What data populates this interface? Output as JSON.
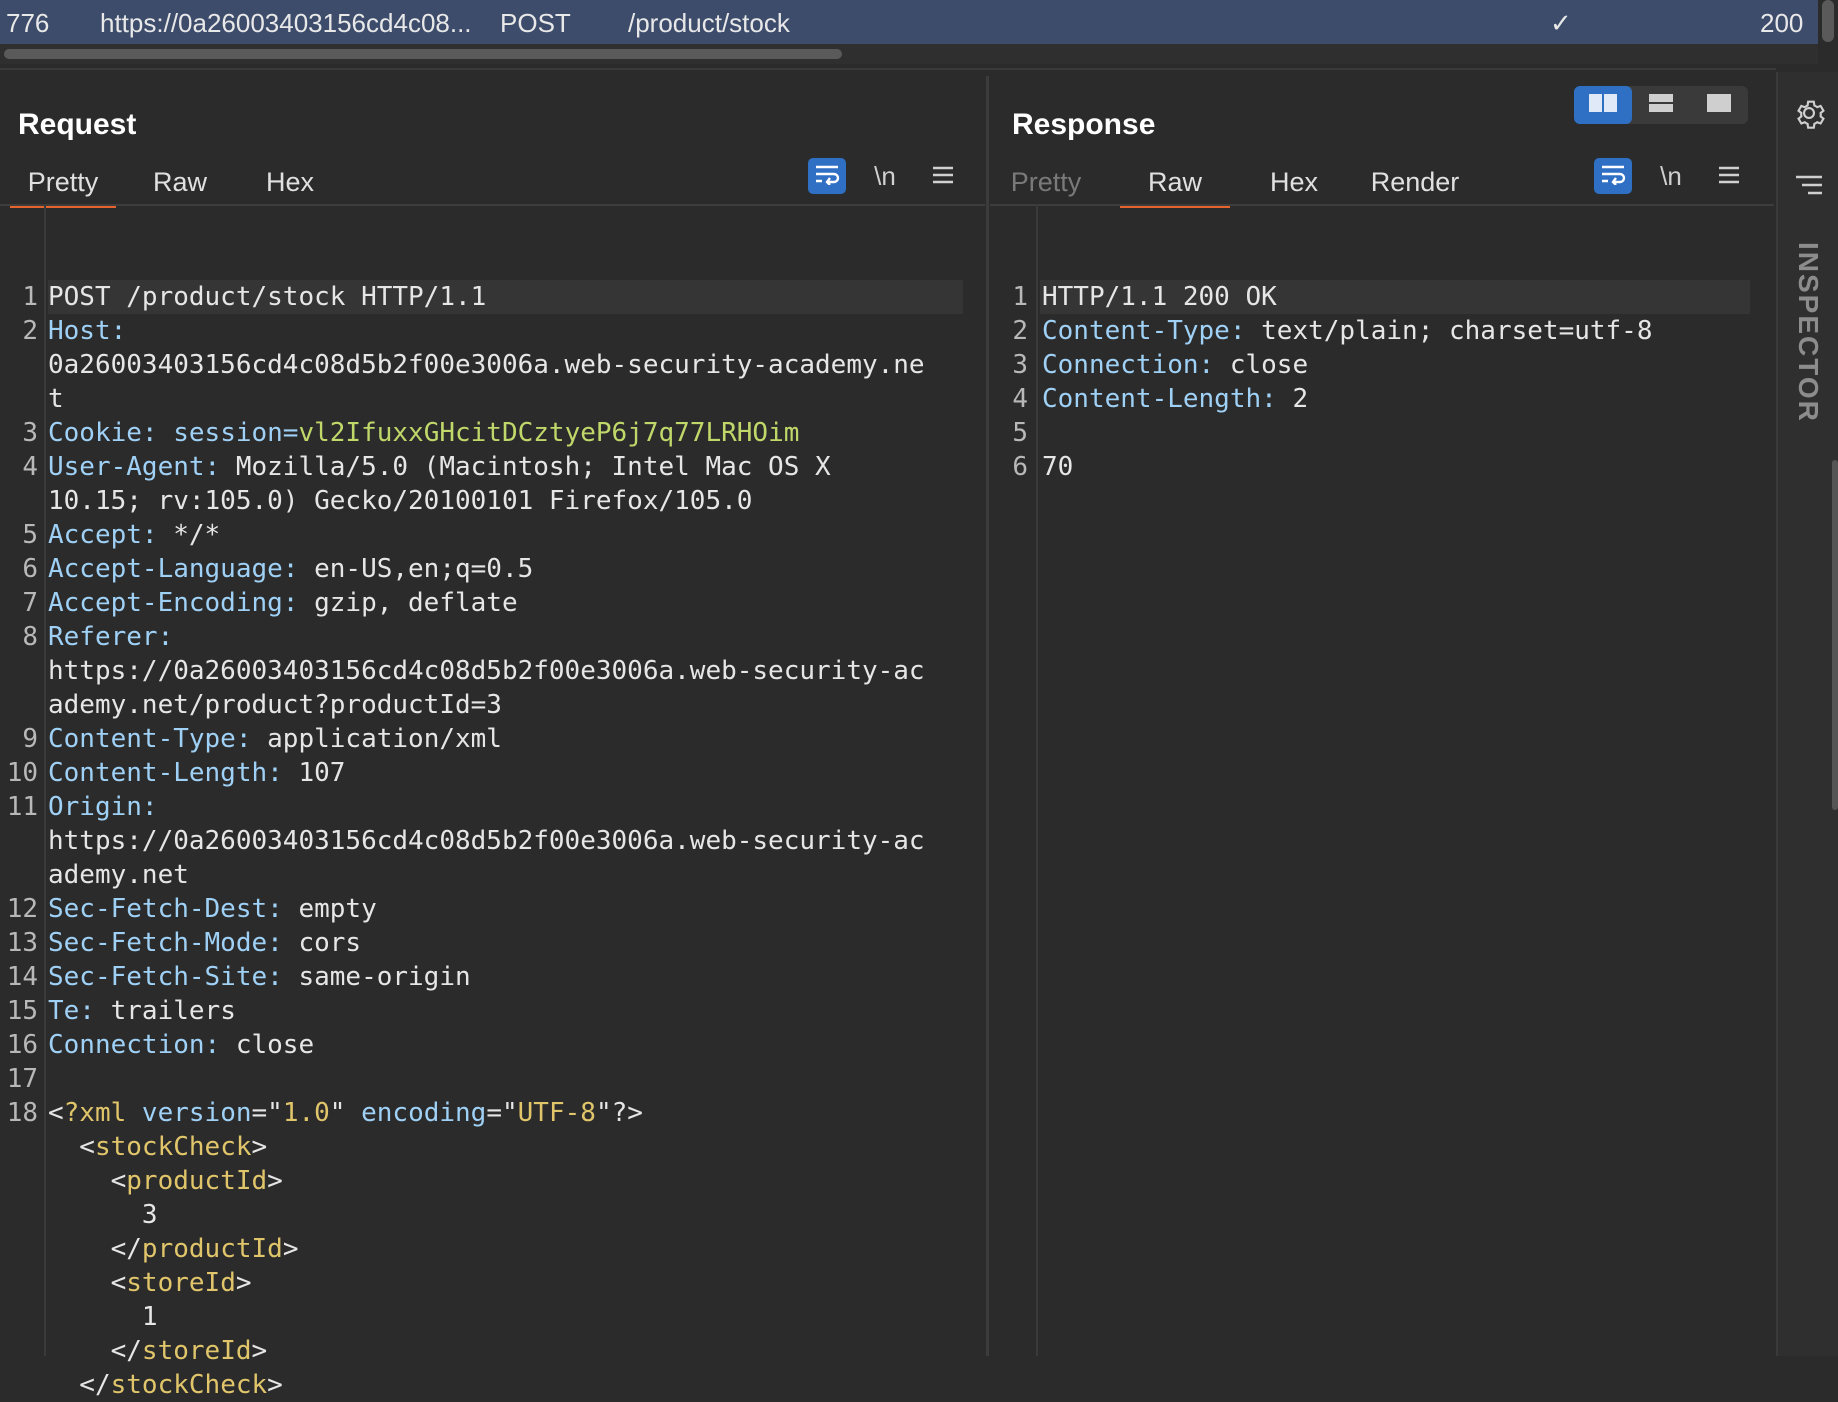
{
  "history_row": {
    "id": "776",
    "url": "https://0a26003403156cd4c08...",
    "method": "POST",
    "path": "/product/stock",
    "edited_mark": "✓",
    "status": "200"
  },
  "request": {
    "title": "Request",
    "tabs": [
      "Pretty",
      "Raw",
      "Hex"
    ],
    "active_tab": "Pretty",
    "lines": [
      {
        "n": "1",
        "parts": [
          {
            "t": "POST /product/stock HTTP/1.1",
            "c": "v"
          }
        ]
      },
      {
        "n": "2",
        "parts": [
          {
            "t": "Host:",
            "c": "k"
          }
        ]
      },
      {
        "n": "",
        "parts": [
          {
            "t": "0a26003403156cd4c08d5b2f00e3006a.web-security-academy.ne",
            "c": "v"
          }
        ]
      },
      {
        "n": "",
        "parts": [
          {
            "t": "t",
            "c": "v"
          }
        ]
      },
      {
        "n": "3",
        "parts": [
          {
            "t": "Cookie: ",
            "c": "k"
          },
          {
            "t": "session=",
            "c": "k"
          },
          {
            "t": "vl2IfuxxGHcitDCztyeP6j7q77LRHOim",
            "c": "cookie-val"
          }
        ]
      },
      {
        "n": "4",
        "parts": [
          {
            "t": "User-Agent: ",
            "c": "k"
          },
          {
            "t": "Mozilla/5.0 (Macintosh; Intel Mac OS X",
            "c": "v"
          }
        ]
      },
      {
        "n": "",
        "parts": [
          {
            "t": "10.15; rv:105.0) Gecko/20100101 Firefox/105.0",
            "c": "v"
          }
        ]
      },
      {
        "n": "5",
        "parts": [
          {
            "t": "Accept: ",
            "c": "k"
          },
          {
            "t": "*/*",
            "c": "v"
          }
        ]
      },
      {
        "n": "6",
        "parts": [
          {
            "t": "Accept-Language: ",
            "c": "k"
          },
          {
            "t": "en-US,en;q=0.5",
            "c": "v"
          }
        ]
      },
      {
        "n": "7",
        "parts": [
          {
            "t": "Accept-Encoding: ",
            "c": "k"
          },
          {
            "t": "gzip, deflate",
            "c": "v"
          }
        ]
      },
      {
        "n": "8",
        "parts": [
          {
            "t": "Referer:",
            "c": "k"
          }
        ]
      },
      {
        "n": "",
        "parts": [
          {
            "t": "https://0a26003403156cd4c08d5b2f00e3006a.web-security-ac",
            "c": "v"
          }
        ]
      },
      {
        "n": "",
        "parts": [
          {
            "t": "ademy.net/product?productId=3",
            "c": "v"
          }
        ]
      },
      {
        "n": "9",
        "parts": [
          {
            "t": "Content-Type: ",
            "c": "k"
          },
          {
            "t": "application/xml",
            "c": "v"
          }
        ]
      },
      {
        "n": "10",
        "parts": [
          {
            "t": "Content-Length: ",
            "c": "k"
          },
          {
            "t": "107",
            "c": "v"
          }
        ]
      },
      {
        "n": "11",
        "parts": [
          {
            "t": "Origin:",
            "c": "k"
          }
        ]
      },
      {
        "n": "",
        "parts": [
          {
            "t": "https://0a26003403156cd4c08d5b2f00e3006a.web-security-ac",
            "c": "v"
          }
        ]
      },
      {
        "n": "",
        "parts": [
          {
            "t": "ademy.net",
            "c": "v"
          }
        ]
      },
      {
        "n": "12",
        "parts": [
          {
            "t": "Sec-Fetch-Dest: ",
            "c": "k"
          },
          {
            "t": "empty",
            "c": "v"
          }
        ]
      },
      {
        "n": "13",
        "parts": [
          {
            "t": "Sec-Fetch-Mode: ",
            "c": "k"
          },
          {
            "t": "cors",
            "c": "v"
          }
        ]
      },
      {
        "n": "14",
        "parts": [
          {
            "t": "Sec-Fetch-Site: ",
            "c": "k"
          },
          {
            "t": "same-origin",
            "c": "v"
          }
        ]
      },
      {
        "n": "15",
        "parts": [
          {
            "t": "Te: ",
            "c": "k"
          },
          {
            "t": "trailers",
            "c": "v"
          }
        ]
      },
      {
        "n": "16",
        "parts": [
          {
            "t": "Connection: ",
            "c": "k"
          },
          {
            "t": "close",
            "c": "v"
          }
        ]
      },
      {
        "n": "17",
        "parts": []
      },
      {
        "n": "18",
        "parts": [
          {
            "t": "<",
            "c": "v"
          },
          {
            "t": "?xml",
            "c": "tag"
          },
          {
            "t": " version",
            "c": "xattr"
          },
          {
            "t": "=\"",
            "c": "v"
          },
          {
            "t": "1.0",
            "c": "xstr"
          },
          {
            "t": "\" ",
            "c": "v"
          },
          {
            "t": "encoding",
            "c": "xattr"
          },
          {
            "t": "=\"",
            "c": "v"
          },
          {
            "t": "UTF-8",
            "c": "xstr"
          },
          {
            "t": "\"?>",
            "c": "v"
          }
        ]
      },
      {
        "n": "",
        "parts": [
          {
            "t": "  <",
            "c": "v"
          },
          {
            "t": "stockCheck",
            "c": "tag"
          },
          {
            "t": ">",
            "c": "v"
          }
        ]
      },
      {
        "n": "",
        "parts": [
          {
            "t": "    <",
            "c": "v"
          },
          {
            "t": "productId",
            "c": "tag"
          },
          {
            "t": ">",
            "c": "v"
          }
        ]
      },
      {
        "n": "",
        "parts": [
          {
            "t": "      3",
            "c": "v"
          }
        ]
      },
      {
        "n": "",
        "parts": [
          {
            "t": "    </",
            "c": "v"
          },
          {
            "t": "productId",
            "c": "tag"
          },
          {
            "t": ">",
            "c": "v"
          }
        ]
      },
      {
        "n": "",
        "parts": [
          {
            "t": "    <",
            "c": "v"
          },
          {
            "t": "storeId",
            "c": "tag"
          },
          {
            "t": ">",
            "c": "v"
          }
        ]
      },
      {
        "n": "",
        "parts": [
          {
            "t": "      1",
            "c": "v"
          }
        ]
      },
      {
        "n": "",
        "parts": [
          {
            "t": "    </",
            "c": "v"
          },
          {
            "t": "storeId",
            "c": "tag"
          },
          {
            "t": ">",
            "c": "v"
          }
        ]
      },
      {
        "n": "",
        "parts": [
          {
            "t": "  </",
            "c": "v"
          },
          {
            "t": "stockCheck",
            "c": "tag"
          },
          {
            "t": ">",
            "c": "v"
          }
        ]
      }
    ]
  },
  "response": {
    "title": "Response",
    "tabs": [
      "Pretty",
      "Raw",
      "Hex",
      "Render"
    ],
    "active_tab": "Raw",
    "lines": [
      {
        "n": "1",
        "parts": [
          {
            "t": "HTTP/1.1 200 OK",
            "c": "v"
          }
        ]
      },
      {
        "n": "2",
        "parts": [
          {
            "t": "Content-Type: ",
            "c": "k"
          },
          {
            "t": "text/plain; charset=utf-8",
            "c": "v"
          }
        ]
      },
      {
        "n": "3",
        "parts": [
          {
            "t": "Connection: ",
            "c": "k"
          },
          {
            "t": "close",
            "c": "v"
          }
        ]
      },
      {
        "n": "4",
        "parts": [
          {
            "t": "Content-Length: ",
            "c": "k"
          },
          {
            "t": "2",
            "c": "v"
          }
        ]
      },
      {
        "n": "5",
        "parts": []
      },
      {
        "n": "6",
        "parts": [
          {
            "t": "70",
            "c": "v"
          }
        ]
      }
    ]
  },
  "toolbar": {
    "wrap_icon": "wrap-lines-icon",
    "newline_label": "\\n",
    "menu_icon": "hamburger-menu-icon"
  },
  "sidebar": {
    "inspector_label": "INSPECTOR",
    "settings_icon": "gear-icon",
    "list_icon": "list-lines-icon"
  },
  "colors": {
    "accent_orange": "#e8642e",
    "active_blue": "#2f6fc4",
    "history_row_bg": "#3d4c6b",
    "header_key": "#9fd0f5",
    "cookie_value": "#c0d76a",
    "xml_tag": "#e0c56a"
  }
}
